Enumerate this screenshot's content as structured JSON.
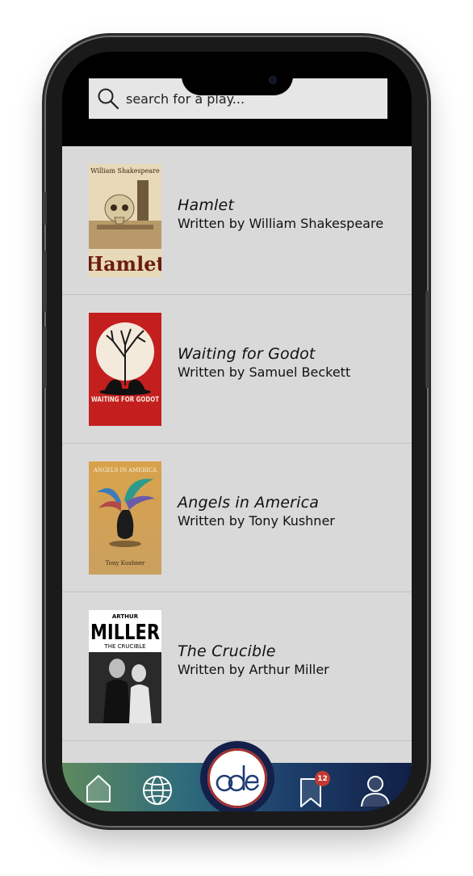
{
  "search": {
    "placeholder": "search for a play..."
  },
  "plays": [
    {
      "title": "Hamlet",
      "author": "Written by William Shakespeare",
      "cover_top_text": "William Shakespeare",
      "cover_bottom_text": "Hamlet"
    },
    {
      "title": "Waiting for Godot",
      "author": "Written by Samuel Beckett",
      "cover_bottom_text": "WAITING FOR GODOT"
    },
    {
      "title": "Angels in America",
      "author": "Written by Tony Kushner",
      "cover_top_text": "ANGELS IN AMERICA",
      "cover_bottom_text": "Tony Kushner"
    },
    {
      "title": "The Crucible",
      "author": "Written by Arthur Miller",
      "cover_top_small": "ARTHUR",
      "cover_top_text": "MILLER",
      "cover_sub_text": "THE CRUCIBLE"
    }
  ],
  "nav": {
    "items": [
      {
        "name": "home",
        "icon": "home-icon"
      },
      {
        "name": "explore",
        "icon": "globe-icon"
      },
      {
        "name": "ode",
        "icon": "ode-logo"
      },
      {
        "name": "bookmarks",
        "icon": "bookmark-icon"
      },
      {
        "name": "profile",
        "icon": "user-icon"
      }
    ],
    "bookmark_count": "12",
    "logo_text": "ode"
  },
  "colors": {
    "list_bg": "#d9d9d9",
    "badge": "#c43a32",
    "nav_dark": "#111f45",
    "nav_green": "#5f8a5e",
    "fab_ring": "#a23030"
  }
}
